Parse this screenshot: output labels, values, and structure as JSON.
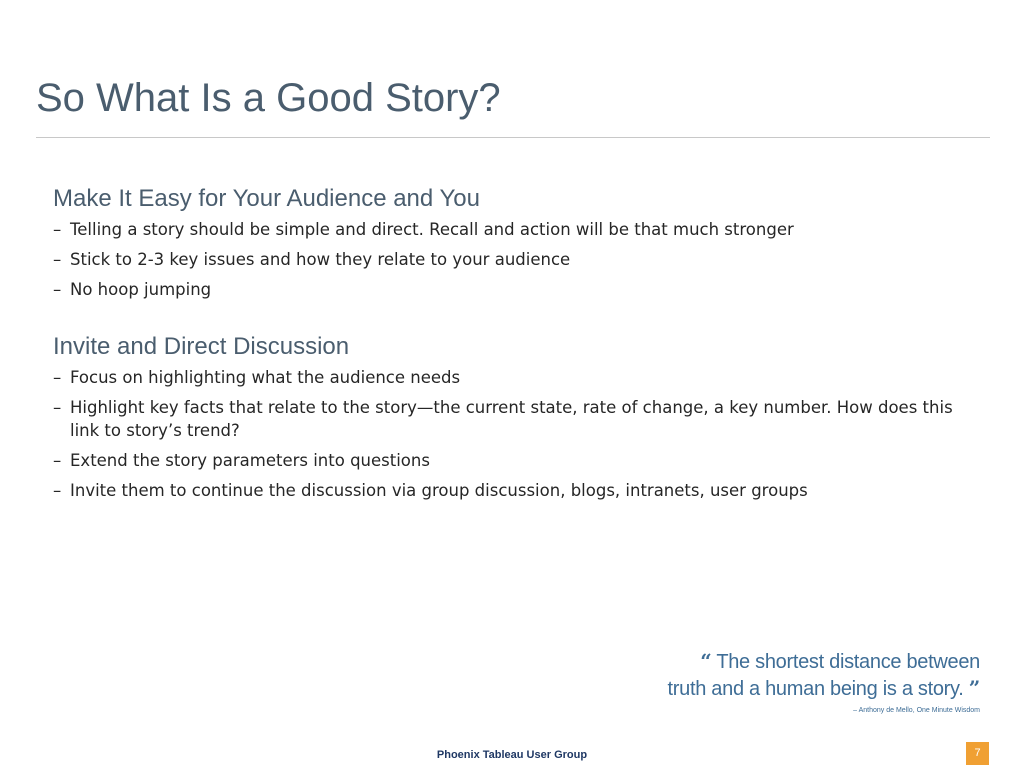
{
  "slide": {
    "title": "So What Is a Good Story?"
  },
  "sections": [
    {
      "heading": "Make It Easy for Your Audience and You",
      "bullets": [
        "Telling a story should be simple and direct. Recall and action will be that much stronger",
        "Stick to 2-3 key issues and how they relate to your audience",
        "No hoop jumping"
      ]
    },
    {
      "heading": "Invite and Direct Discussion",
      "bullets": [
        "Focus on highlighting what the audience needs",
        "Highlight key facts that relate to the story—the current state, rate of change, a key number. How does this link to story’s trend?",
        "Extend the story parameters into questions",
        "Invite them to continue the discussion via group discussion, blogs, intranets, user groups"
      ]
    }
  ],
  "bullet_marker": "–",
  "quote": {
    "open_mark": "“",
    "line1": "The shortest distance between",
    "line2": "truth and a human being is a story.",
    "close_mark": "”",
    "attribution": "– Anthony de Mello, One Minute Wisdom"
  },
  "footer": {
    "text": "Phoenix Tableau User Group",
    "page_number": "7"
  },
  "colors": {
    "heading": "#4a5d6e",
    "body_text": "#262626",
    "quote": "#3e6d96",
    "page_badge": "#f0a033"
  }
}
